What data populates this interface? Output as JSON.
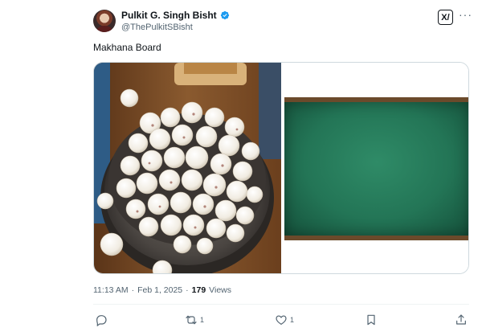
{
  "author": {
    "display_name": "Pulkit G. Singh Bisht",
    "handle": "@ThePulkitSBisht"
  },
  "tweet": {
    "text": "Makhana Board",
    "time": "11:13 AM",
    "separator": "·",
    "date": "Feb 1, 2025",
    "views_count": "179",
    "views_label": "Views"
  },
  "header_buttons": {
    "grok_label": "X/",
    "more_label": "···"
  },
  "actions": {
    "reply_count": "",
    "repost_count": "1",
    "like_count": "1",
    "bookmark_count": "",
    "share_count": ""
  },
  "icons": {
    "verified": "verified-badge-icon",
    "reply": "reply-icon",
    "repost": "repost-icon",
    "like": "heart-icon",
    "bookmark": "bookmark-icon",
    "share": "share-icon"
  },
  "colors": {
    "text_primary": "#0f1419",
    "text_secondary": "#536471",
    "verified_blue": "#1d9bf0",
    "border": "#cfd9de",
    "chalkboard_green": "#237556",
    "chalkboard_frame": "#6b4a2b"
  }
}
